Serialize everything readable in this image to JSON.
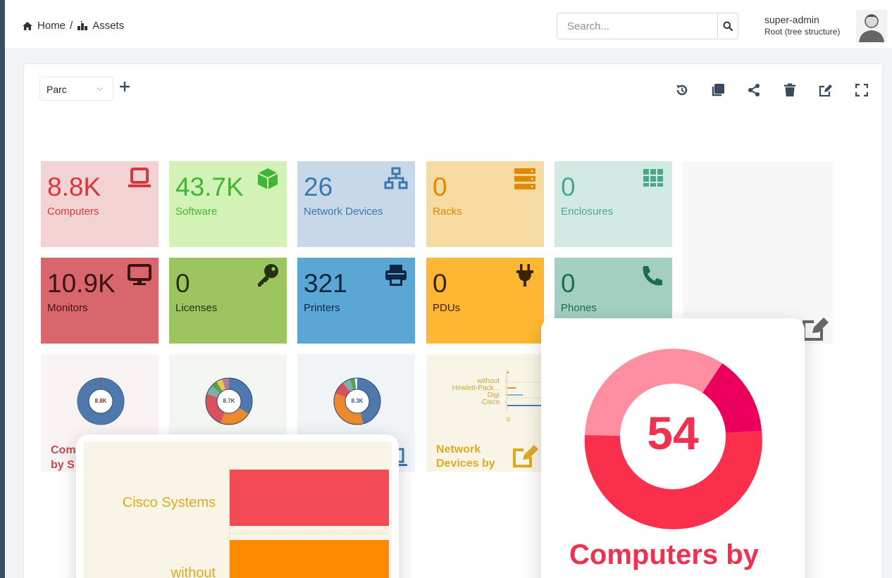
{
  "breadcrumb": {
    "home": "Home",
    "separator": "/",
    "assets": "Assets"
  },
  "search": {
    "placeholder": "Search..."
  },
  "user": {
    "name": "super-admin",
    "entity": "Root (tree structure)"
  },
  "dashboard": {
    "selected": "Parc"
  },
  "toolbar": {
    "icons": [
      "history-icon",
      "clone-icon",
      "share-icon",
      "trash-icon",
      "edit-icon",
      "fullscreen-icon"
    ]
  },
  "tiles": [
    {
      "value": "8.8K",
      "label": "Computers",
      "icon": "laptop-icon"
    },
    {
      "value": "43.7K",
      "label": "Software",
      "icon": "cube-icon"
    },
    {
      "value": "26",
      "label": "Network Devices",
      "icon": "network-icon"
    },
    {
      "value": "0",
      "label": "Racks",
      "icon": "server-icon"
    },
    {
      "value": "0",
      "label": "Enclosures",
      "icon": "grid-icon"
    },
    {
      "value": "10.9K",
      "label": "Monitors",
      "icon": "desktop-icon"
    },
    {
      "value": "0",
      "label": "Licenses",
      "icon": "key-icon"
    },
    {
      "value": "321",
      "label": "Printers",
      "icon": "print-icon"
    },
    {
      "value": "0",
      "label": "PDUs",
      "icon": "plug-icon"
    },
    {
      "value": "0",
      "label": "Phones",
      "icon": "phone-icon"
    }
  ],
  "mini": {
    "pie1": {
      "center": "8.8K",
      "title_line1": "Com",
      "title_line2": "by S"
    },
    "pie2": {
      "center": "8.7K"
    },
    "pie3": {
      "center": "8.3K"
    },
    "network": {
      "legend": [
        "without",
        "Hewlett-Pack...",
        "Digi",
        "Cisco"
      ],
      "axis_zero": "0",
      "title_line1": "Network",
      "title_line2": "Devices by"
    }
  },
  "popup_left": {
    "rows": [
      {
        "label": "Cisco Systems",
        "color": "#f24b55"
      },
      {
        "label": "without",
        "color": "#ff8a00"
      }
    ]
  },
  "popup_right": {
    "value": "54",
    "title": "Computers by"
  },
  "colors": {
    "computers": "#f3d2d4",
    "software": "#d3f3b6",
    "network": "#c7d9e8",
    "racks": "#f5dba2",
    "enclosures": "#d3e9e3",
    "monitors": "#d9666c",
    "licenses": "#9cc560",
    "printers": "#5aa7d6",
    "pdus": "#ffb733",
    "phones": "#a2cfc0"
  }
}
